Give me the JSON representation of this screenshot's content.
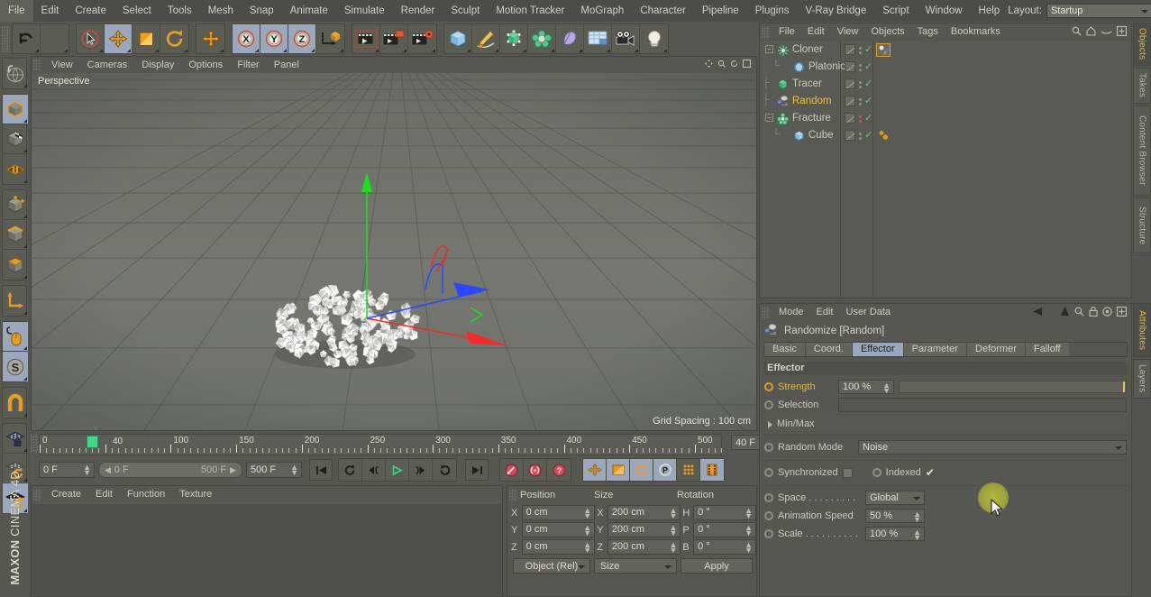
{
  "menubar": {
    "items": [
      "File",
      "Edit",
      "Create",
      "Select",
      "Tools",
      "Mesh",
      "Snap",
      "Animate",
      "Simulate",
      "Render",
      "Sculpt",
      "Motion Tracker",
      "MoGraph",
      "Character",
      "Pipeline",
      "Plugins",
      "V-Ray Bridge",
      "Script",
      "Window",
      "Help"
    ],
    "layout_label": "Layout:",
    "layout_value": "Startup"
  },
  "toolbar": {
    "groups": [
      {
        "name": "undo-redo",
        "buttons": [
          {
            "name": "undo",
            "icon": "undo-arrow-icon",
            "active": false
          },
          {
            "name": "redo",
            "icon": "redo-arrow-icon",
            "active": false
          }
        ]
      },
      {
        "name": "transform-tools",
        "buttons": [
          {
            "name": "live-selection",
            "icon": "cursor-arrow-icon",
            "active": false
          },
          {
            "name": "move",
            "icon": "move-cross-icon",
            "active": true
          },
          {
            "name": "scale",
            "icon": "scale-square-icon",
            "active": false
          },
          {
            "name": "rotate",
            "icon": "rotate-circle-icon",
            "active": false
          }
        ]
      },
      {
        "name": "world-object-axis",
        "buttons": [
          {
            "name": "world-axis",
            "icon": "move-cross-icon",
            "active": false
          }
        ]
      },
      {
        "name": "axis-locks",
        "buttons": [
          {
            "name": "lock-x",
            "icon": "x-axis-icon",
            "active": true
          },
          {
            "name": "lock-y",
            "icon": "y-axis-icon",
            "active": true
          },
          {
            "name": "lock-z",
            "icon": "z-axis-icon",
            "active": true
          },
          {
            "name": "world-coordinates",
            "icon": "world-axis-icon",
            "active": false
          }
        ]
      },
      {
        "name": "render-tools",
        "buttons": [
          {
            "name": "render-view",
            "icon": "render-view-icon",
            "active": false
          },
          {
            "name": "render-region",
            "icon": "render-region-icon",
            "active": false
          },
          {
            "name": "render-settings",
            "icon": "render-settings-icon",
            "active": false
          }
        ]
      },
      {
        "name": "object-primitives",
        "buttons": [
          {
            "name": "add-cube",
            "icon": "cube-icon",
            "active": false
          },
          {
            "name": "add-spline",
            "icon": "pen-spline-icon",
            "active": false
          },
          {
            "name": "add-generator",
            "icon": "generator-icon",
            "active": false
          },
          {
            "name": "add-mograph",
            "icon": "mograph-icon",
            "active": false
          },
          {
            "name": "add-deformer",
            "icon": "deformer-icon",
            "active": false
          },
          {
            "name": "add-environment",
            "icon": "environment-icon",
            "active": false
          },
          {
            "name": "add-camera",
            "icon": "camera-icon",
            "active": false
          },
          {
            "name": "add-light",
            "icon": "light-bulb-icon",
            "active": false
          }
        ]
      }
    ]
  },
  "leftbar": {
    "groups": [
      {
        "name": "undo-view",
        "buttons": [
          {
            "name": "undo-view",
            "icon": "globe-undo-icon",
            "active": false
          }
        ]
      },
      {
        "name": "editor-modes",
        "buttons": [
          {
            "name": "make-editable",
            "icon": "editable-cube-icon",
            "active": true
          },
          {
            "name": "model-mode",
            "icon": "model-cube-icon",
            "active": false
          },
          {
            "name": "texture-mode",
            "icon": "texture-grid-icon",
            "active": false
          }
        ]
      },
      {
        "name": "component-modes",
        "buttons": [
          {
            "name": "points-mode",
            "icon": "points-cube-icon",
            "active": false
          },
          {
            "name": "edges-mode",
            "icon": "edges-cube-icon",
            "active": false
          },
          {
            "name": "polygons-mode",
            "icon": "polygons-cube-icon",
            "active": false
          }
        ]
      },
      {
        "name": "axis-mode",
        "buttons": [
          {
            "name": "enable-axis",
            "icon": "axis-l-icon",
            "active": false
          }
        ]
      },
      {
        "name": "viewport-interact",
        "buttons": [
          {
            "name": "viewport-solo",
            "icon": "mouse-icon",
            "active": true
          },
          {
            "name": "enable-snap",
            "icon": "snap-s-icon",
            "active": true
          }
        ]
      },
      {
        "name": "magnet",
        "buttons": [
          {
            "name": "magnet-tool",
            "icon": "magnet-icon",
            "active": false
          }
        ]
      },
      {
        "name": "locks",
        "buttons": [
          {
            "name": "lock-workplane",
            "icon": "workplane-lock-icon",
            "active": false
          },
          {
            "name": "workplane-mode",
            "icon": "workplane-rotate-icon",
            "active": false
          },
          {
            "name": "workplane-toggle",
            "icon": "workplane-toggle-icon",
            "active": true
          }
        ]
      }
    ],
    "brand_bold": "MAXON",
    "brand_light": "CINEMA 4D"
  },
  "viewport": {
    "menu": [
      "View",
      "Cameras",
      "Display",
      "Options",
      "Filter",
      "Panel"
    ],
    "corner_icons": [
      "pan-icon",
      "zoom-icon",
      "rotate-icon",
      "maximize-icon"
    ],
    "label": "Perspective",
    "grid_spacing": "Grid Spacing : 100 cm",
    "axis_labels": {
      "x": "X",
      "y": "Y",
      "z": "Z"
    }
  },
  "timeline": {
    "start_frame_value": "0 F",
    "end_frame_value": "500 F",
    "range_start": "0 F",
    "range_end": "500 F",
    "current_frame": "40 F",
    "playhead_label": "40",
    "ruler_min": 0,
    "ruler_max": 520,
    "ruler_ticks": [
      0,
      50,
      100,
      150,
      200,
      250,
      300,
      350,
      400,
      450,
      500
    ],
    "ruler_labels": [
      "0",
      "",
      "100",
      "150",
      "200",
      "250",
      "300",
      "350",
      "400",
      "450",
      "500"
    ],
    "transport": [
      {
        "name": "go-to-start",
        "icon": "skip-start-icon",
        "active": false
      },
      {
        "name": "frame-back-fast",
        "icon": "rewind-loop-icon",
        "active": false
      },
      {
        "name": "frame-back",
        "icon": "step-back-icon",
        "active": false
      },
      {
        "name": "play",
        "icon": "play-icon",
        "active": false
      },
      {
        "name": "frame-forward",
        "icon": "step-forward-icon",
        "active": false
      },
      {
        "name": "loop-playback",
        "icon": "loop-icon",
        "active": false
      },
      {
        "name": "go-to-end",
        "icon": "skip-end-icon",
        "active": false
      }
    ],
    "record_group": [
      {
        "name": "record-active-objects",
        "icon": "record-key-icon",
        "active": false
      },
      {
        "name": "autokeying",
        "icon": "autokey-icon",
        "active": false
      },
      {
        "name": "keyframe-selection",
        "icon": "question-key-icon",
        "active": false
      }
    ],
    "key_group": [
      {
        "name": "position-key",
        "icon": "position-key-icon",
        "active": true
      },
      {
        "name": "scale-key",
        "icon": "scale-key-icon",
        "active": true
      },
      {
        "name": "rotation-key",
        "icon": "rotation-key-icon",
        "active": true
      },
      {
        "name": "parameter-key",
        "icon": "parameter-key-icon",
        "active": true
      },
      {
        "name": "point-level-animation",
        "icon": "pla-dots-icon",
        "active": false
      },
      {
        "name": "timeline-strip",
        "icon": "film-strip-icon",
        "active": true
      }
    ]
  },
  "material_manager": {
    "menu": [
      "Create",
      "Edit",
      "Function",
      "Texture"
    ],
    "materials": []
  },
  "coordinates": {
    "columns": [
      "Position",
      "Size",
      "Rotation"
    ],
    "rows": [
      {
        "pos_axis": "X",
        "pos_value": "0 cm",
        "size_axis": "X",
        "size_value": "200 cm",
        "rot_axis": "H",
        "rot_value": "0 °"
      },
      {
        "pos_axis": "Y",
        "pos_value": "0 cm",
        "size_axis": "Y",
        "size_value": "200 cm",
        "rot_axis": "P",
        "rot_value": "0 °"
      },
      {
        "pos_axis": "Z",
        "pos_value": "0 cm",
        "size_axis": "Z",
        "size_value": "200 cm",
        "rot_axis": "B",
        "rot_value": "0 °"
      }
    ],
    "mode_select": "Object (Rel)",
    "size_select": "Size",
    "apply_button": "Apply"
  },
  "object_manager": {
    "menu": [
      "File",
      "Edit",
      "View",
      "Objects",
      "Tags",
      "Bookmarks"
    ],
    "header_icons": [
      "search-icon",
      "home-icon",
      "eye-icon",
      "plus-box-icon"
    ],
    "items": [
      {
        "name": "Cloner",
        "icon": "cloner-icon",
        "depth": 0,
        "selected": false,
        "expandable": true,
        "dots": "gray",
        "tag": "cloner-tag"
      },
      {
        "name": "Platonic",
        "icon": "platonic-icon",
        "depth": 1,
        "selected": false,
        "expandable": false,
        "dots": "gray",
        "tag": ""
      },
      {
        "name": "Tracer",
        "icon": "tracer-icon",
        "depth": 0,
        "selected": false,
        "expandable": false,
        "dots": "gray",
        "tag": ""
      },
      {
        "name": "Random",
        "icon": "random-icon",
        "depth": 0,
        "selected": true,
        "expandable": false,
        "dots": "gray",
        "tag": ""
      },
      {
        "name": "Fracture",
        "icon": "fracture-icon",
        "depth": 0,
        "selected": false,
        "expandable": true,
        "dots": "red",
        "tag": ""
      },
      {
        "name": "Cube",
        "icon": "cube-obj-icon",
        "depth": 1,
        "selected": false,
        "expandable": false,
        "dots": "gray",
        "tag": "dynamics-tag"
      }
    ]
  },
  "attribute_manager": {
    "menu": [
      "Mode",
      "Edit",
      "User Data"
    ],
    "header_icons": [
      "back-arrow-icon",
      "up-arrow-icon",
      "search-icon",
      "lock-icon",
      "target-icon",
      "plus-box-icon"
    ],
    "object_title": "Randomize [Random]",
    "object_icon": "random-effector-icon",
    "tabs": [
      {
        "label": "Basic",
        "active": false
      },
      {
        "label": "Coord.",
        "active": false
      },
      {
        "label": "Effector",
        "active": true
      },
      {
        "label": "Parameter",
        "active": false
      },
      {
        "label": "Deformer",
        "active": false
      },
      {
        "label": "Falloff",
        "active": false
      }
    ],
    "section_label": "Effector",
    "fields": {
      "strength_label": "Strength",
      "strength_value": "100 %",
      "selection_label": "Selection",
      "selection_value": "",
      "minmax_label": "Min/Max",
      "random_mode_label": "Random Mode",
      "random_mode_value": "Noise",
      "synchronized_label": "Synchronized",
      "synchronized_checked": false,
      "indexed_label": "Indexed",
      "indexed_checked": true,
      "space_label": "Space . . . . . . . . .",
      "space_value": "Global",
      "animation_speed_label": "Animation Speed",
      "animation_speed_value": "50 %",
      "scale_label": "Scale . . . . . . . . . .",
      "scale_value": "100 %"
    }
  },
  "right_tabs_top": [
    {
      "label": "Objects",
      "active": true
    },
    {
      "label": "Takes",
      "active": false
    },
    {
      "label": "Content Browser",
      "active": false
    },
    {
      "label": "Structure",
      "active": false
    }
  ],
  "right_tabs_bottom": [
    {
      "label": "Attributes",
      "active": true
    },
    {
      "label": "Layers",
      "active": false
    }
  ],
  "colors": {
    "accent_yellow": "#f1c233",
    "selected_tab": "#9aa7bd",
    "panel_bg": "#565750",
    "field_bg": "#5f6059",
    "play_green": "#45d68a",
    "orange": "#e09a22"
  }
}
